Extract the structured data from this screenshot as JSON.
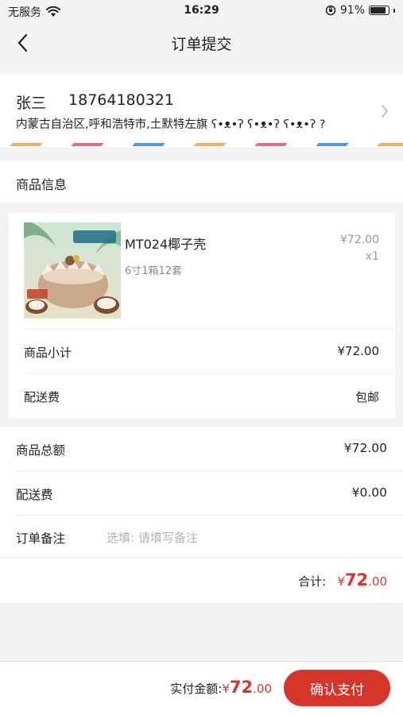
{
  "status_bar": {
    "carrier": "无服务",
    "time": "16:29",
    "battery": "91%"
  },
  "nav": {
    "title": "订单提交"
  },
  "address": {
    "name": "张三",
    "phone": "18764180321",
    "detail": "内蒙古自治区,呼和浩特市,土默特左旗 ʕ•ᴥ•ʔ ʕ•ᴥ•ʔ ʕ•ᴥ•ʔ ?",
    "stripe_colors": [
      "#f2b25c",
      "#ea6a7f",
      "#4a9be4"
    ]
  },
  "goods_section": {
    "title": "商品信息"
  },
  "goods": {
    "name": "MT024椰子壳",
    "spec": "6寸1箱12套",
    "price": "¥72.00",
    "quantity": "x1",
    "subtotal_label": "商品小计",
    "subtotal_value": "¥72.00",
    "shipping_label": "配送费",
    "shipping_value": "包邮"
  },
  "summary": {
    "goods_total_label": "商品总额",
    "goods_total_value": "¥72.00",
    "shipping_label": "配送费",
    "shipping_value": "¥0.00",
    "note_label": "订单备注",
    "note_placeholder": "选填: 请填写备注",
    "note_value": "",
    "total_label": "合计:",
    "total_currency": "¥",
    "total_int": "72",
    "total_dec": ".00"
  },
  "bottom": {
    "pay_label": "实付金额:",
    "pay_currency": "¥",
    "pay_int": "72",
    "pay_dec": ".00",
    "confirm_label": "确认支付"
  },
  "colors": {
    "accent": "#d8352a",
    "price_red": "#d5362b"
  }
}
